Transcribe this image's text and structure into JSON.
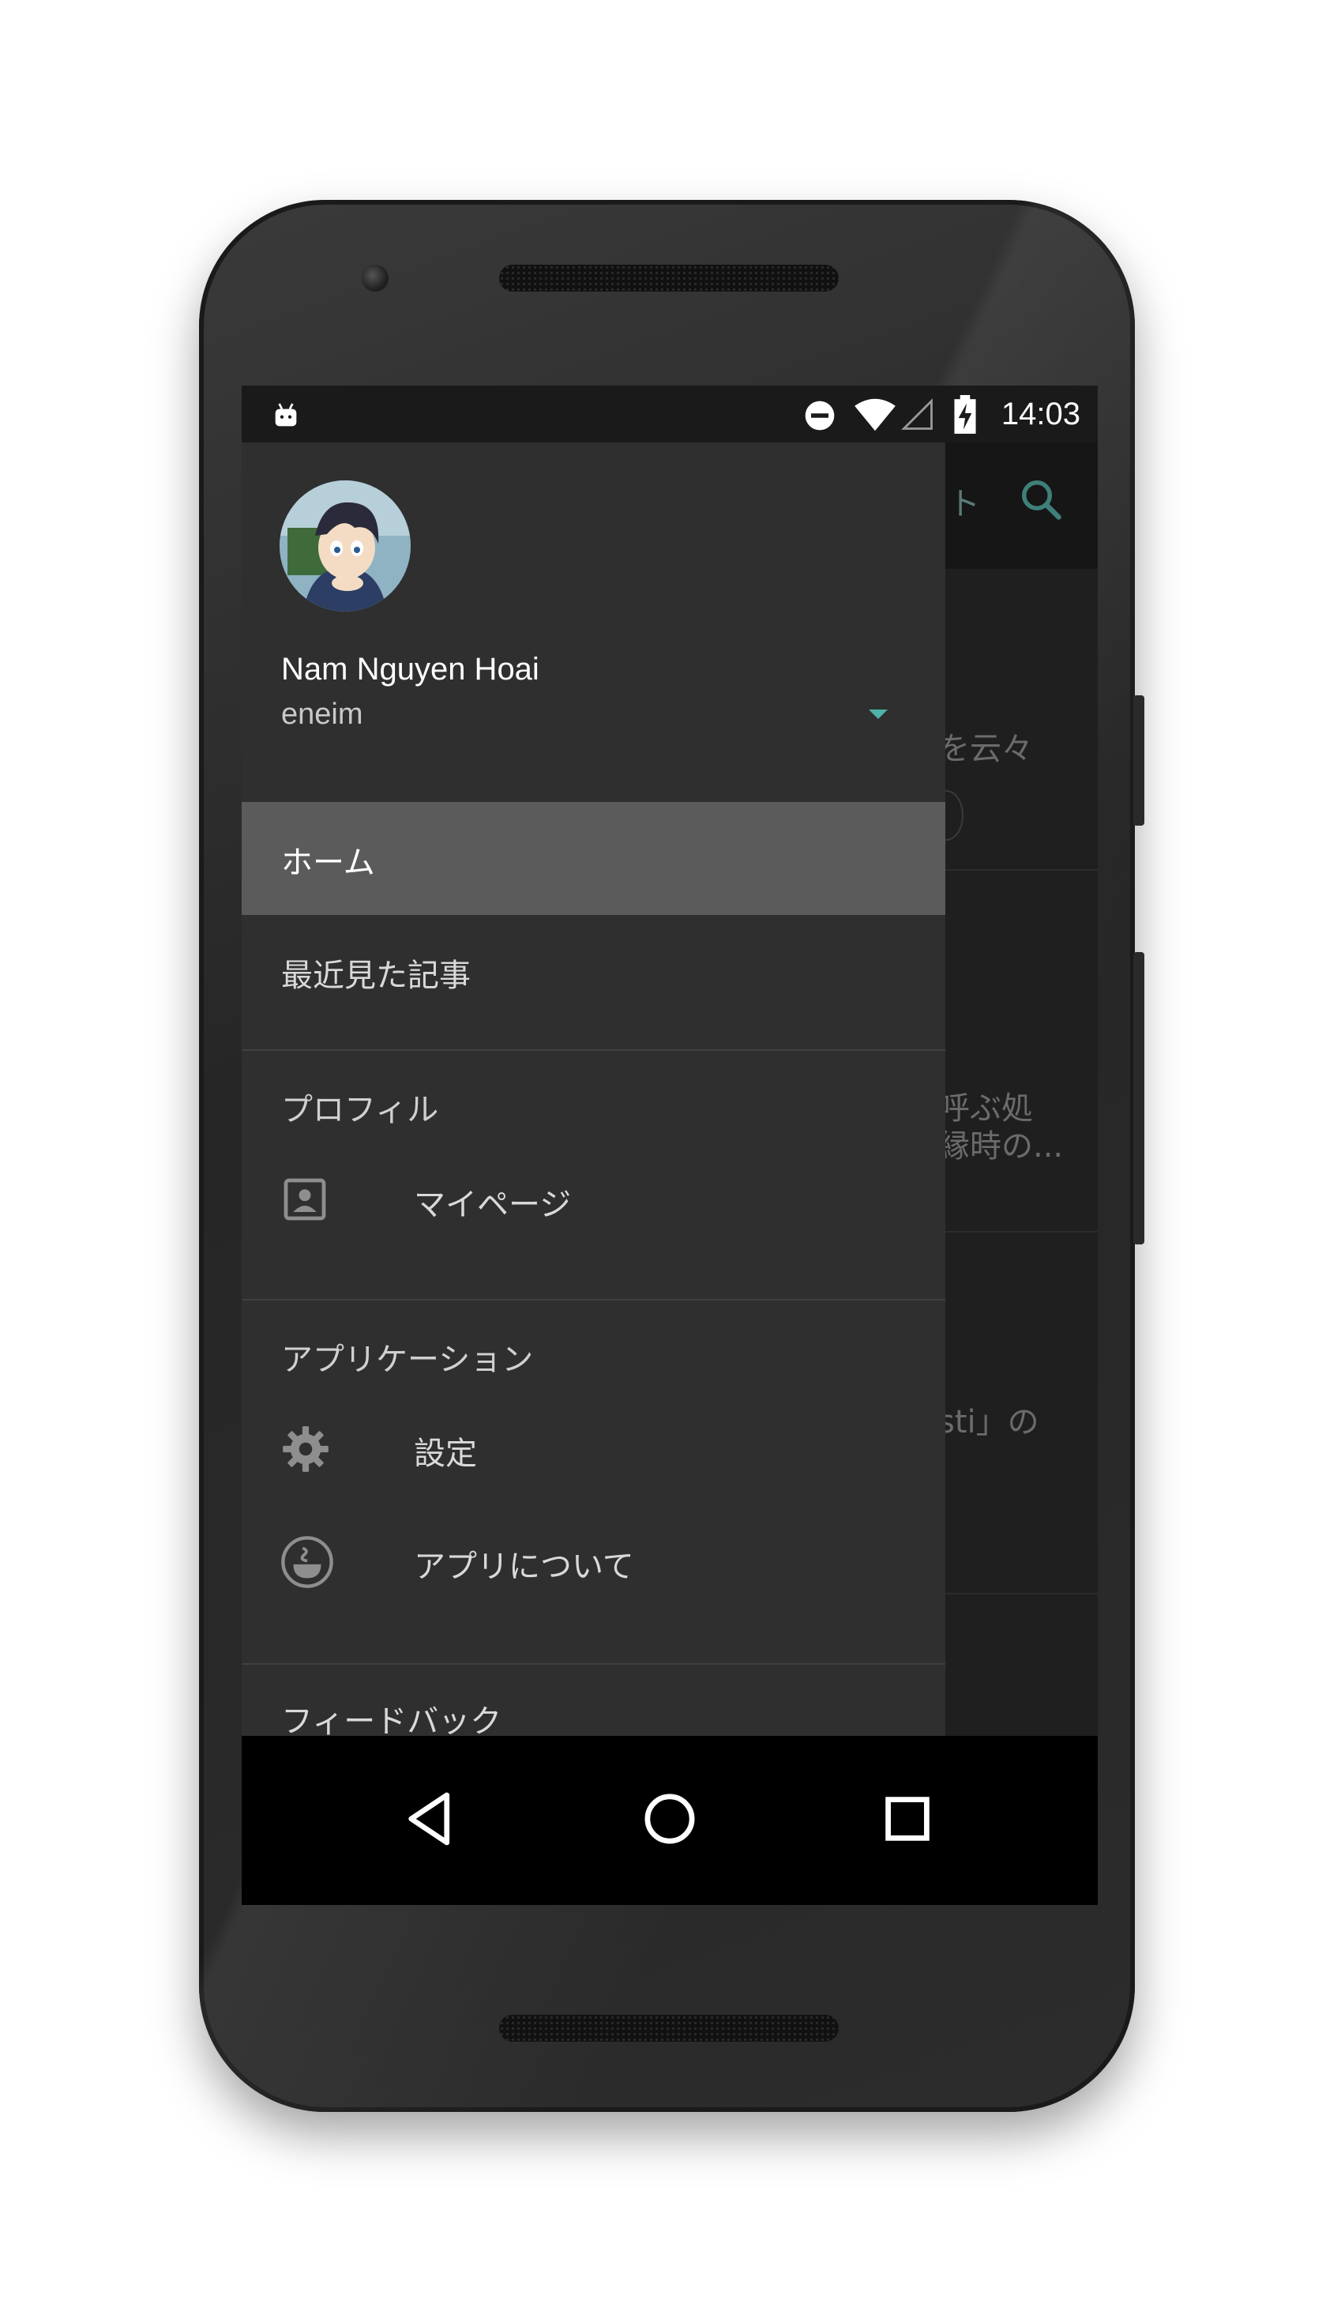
{
  "status_bar": {
    "time": "14:03",
    "icons": [
      "android-debug-icon",
      "do-not-disturb-icon",
      "wifi-icon",
      "cellular-signal-icon",
      "battery-charging-icon"
    ]
  },
  "drawer": {
    "header": {
      "user_name": "Nam Nguyen Hoai",
      "user_handle": "eneim"
    },
    "items": {
      "home": "ホーム",
      "recent": "最近見た記事"
    },
    "sections": {
      "profile": {
        "title": "プロフィル",
        "my_page": "マイページ"
      },
      "application": {
        "title": "アプリケーション",
        "settings": "設定",
        "about": "アプリについて"
      },
      "feedback": "フィードバック"
    }
  },
  "background_app": {
    "toolbar_text": "ト",
    "peek_texts": [
      "を云々",
      "呼ぶ処",
      "縁時の...",
      "sti」の"
    ]
  },
  "colors": {
    "accent": "#4fb3a9",
    "drawer_bg": "#2f2f2f",
    "selected_bg": "#5b5b5b"
  }
}
